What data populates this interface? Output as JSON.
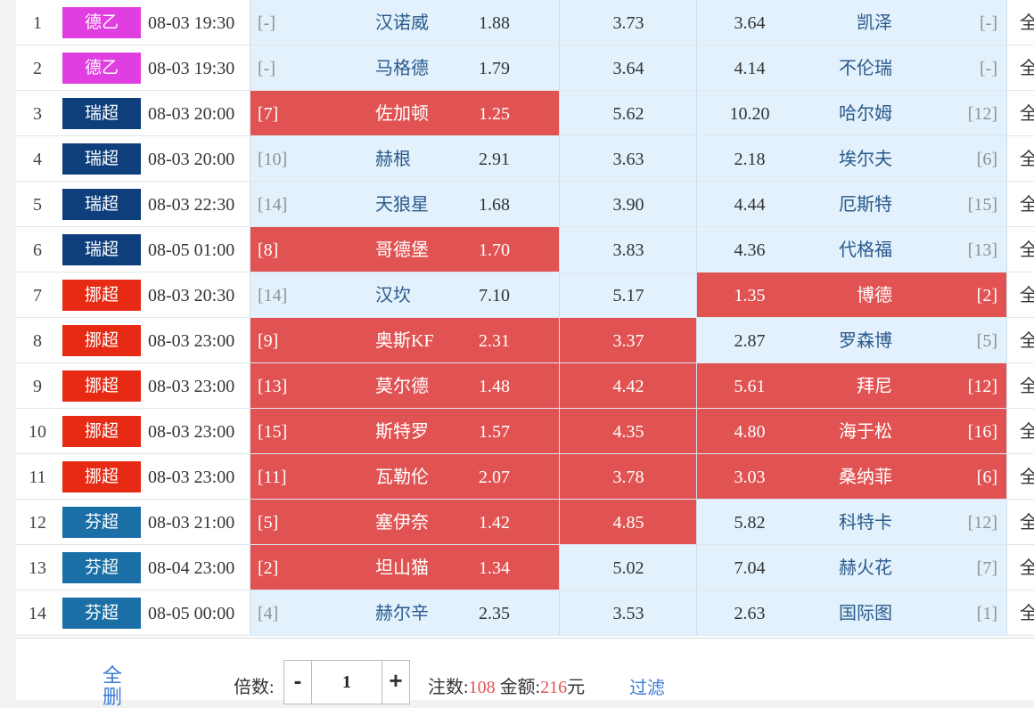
{
  "colors": {
    "德乙": "#e03ee0",
    "瑞超": "#0e3f7c",
    "挪超": "#e62a13",
    "芬超": "#1a6fa7",
    "selected": "#e15353",
    "cell_bg": "#e2f1fc"
  },
  "matches": [
    {
      "no": "1",
      "league": "德乙",
      "time": "08-03 19:30",
      "home_rank": "[-]",
      "home": "汉诺威",
      "win": "1.88",
      "draw": "3.73",
      "lose": "3.64",
      "away": "凯泽",
      "away_rank": "[-]",
      "all": "全",
      "sel_home": false,
      "sel_draw": false,
      "sel_away": false
    },
    {
      "no": "2",
      "league": "德乙",
      "time": "08-03 19:30",
      "home_rank": "[-]",
      "home": "马格德",
      "win": "1.79",
      "draw": "3.64",
      "lose": "4.14",
      "away": "不伦瑞",
      "away_rank": "[-]",
      "all": "全",
      "sel_home": false,
      "sel_draw": false,
      "sel_away": false
    },
    {
      "no": "3",
      "league": "瑞超",
      "time": "08-03 20:00",
      "home_rank": "[7]",
      "home": "佐加顿",
      "win": "1.25",
      "draw": "5.62",
      "lose": "10.20",
      "away": "哈尔姆",
      "away_rank": "[12]",
      "all": "全",
      "sel_home": true,
      "sel_draw": false,
      "sel_away": false
    },
    {
      "no": "4",
      "league": "瑞超",
      "time": "08-03 20:00",
      "home_rank": "[10]",
      "home": "赫根",
      "win": "2.91",
      "draw": "3.63",
      "lose": "2.18",
      "away": "埃尔夫",
      "away_rank": "[6]",
      "all": "全",
      "sel_home": false,
      "sel_draw": false,
      "sel_away": false
    },
    {
      "no": "5",
      "league": "瑞超",
      "time": "08-03 22:30",
      "home_rank": "[14]",
      "home": "天狼星",
      "win": "1.68",
      "draw": "3.90",
      "lose": "4.44",
      "away": "厄斯特",
      "away_rank": "[15]",
      "all": "全",
      "sel_home": false,
      "sel_draw": false,
      "sel_away": false
    },
    {
      "no": "6",
      "league": "瑞超",
      "time": "08-05 01:00",
      "home_rank": "[8]",
      "home": "哥德堡",
      "win": "1.70",
      "draw": "3.83",
      "lose": "4.36",
      "away": "代格福",
      "away_rank": "[13]",
      "all": "全",
      "sel_home": true,
      "sel_draw": false,
      "sel_away": false
    },
    {
      "no": "7",
      "league": "挪超",
      "time": "08-03 20:30",
      "home_rank": "[14]",
      "home": "汉坎",
      "win": "7.10",
      "draw": "5.17",
      "lose": "1.35",
      "away": "博德",
      "away_rank": "[2]",
      "all": "全",
      "sel_home": false,
      "sel_draw": false,
      "sel_away": true
    },
    {
      "no": "8",
      "league": "挪超",
      "time": "08-03 23:00",
      "home_rank": "[9]",
      "home": "奥斯KF",
      "win": "2.31",
      "draw": "3.37",
      "lose": "2.87",
      "away": "罗森博",
      "away_rank": "[5]",
      "all": "全",
      "sel_home": true,
      "sel_draw": true,
      "sel_away": false
    },
    {
      "no": "9",
      "league": "挪超",
      "time": "08-03 23:00",
      "home_rank": "[13]",
      "home": "莫尔德",
      "win": "1.48",
      "draw": "4.42",
      "lose": "5.61",
      "away": "拜尼",
      "away_rank": "[12]",
      "all": "全",
      "sel_home": true,
      "sel_draw": true,
      "sel_away": true
    },
    {
      "no": "10",
      "league": "挪超",
      "time": "08-03 23:00",
      "home_rank": "[15]",
      "home": "斯特罗",
      "win": "1.57",
      "draw": "4.35",
      "lose": "4.80",
      "away": "海于松",
      "away_rank": "[16]",
      "all": "全",
      "sel_home": true,
      "sel_draw": true,
      "sel_away": true
    },
    {
      "no": "11",
      "league": "挪超",
      "time": "08-03 23:00",
      "home_rank": "[11]",
      "home": "瓦勒伦",
      "win": "2.07",
      "draw": "3.78",
      "lose": "3.03",
      "away": "桑纳菲",
      "away_rank": "[6]",
      "all": "全",
      "sel_home": true,
      "sel_draw": true,
      "sel_away": true
    },
    {
      "no": "12",
      "league": "芬超",
      "time": "08-03 21:00",
      "home_rank": "[5]",
      "home": "塞伊奈",
      "win": "1.42",
      "draw": "4.85",
      "lose": "5.82",
      "away": "科特卡",
      "away_rank": "[12]",
      "all": "全",
      "sel_home": true,
      "sel_draw": true,
      "sel_away": false
    },
    {
      "no": "13",
      "league": "芬超",
      "time": "08-04 23:00",
      "home_rank": "[2]",
      "home": "坦山猫",
      "win": "1.34",
      "draw": "5.02",
      "lose": "7.04",
      "away": "赫火花",
      "away_rank": "[7]",
      "all": "全",
      "sel_home": true,
      "sel_draw": false,
      "sel_away": false
    },
    {
      "no": "14",
      "league": "芬超",
      "time": "08-05 00:00",
      "home_rank": "[4]",
      "home": "赫尔辛",
      "win": "2.35",
      "draw": "3.53",
      "lose": "2.63",
      "away": "国际图",
      "away_rank": "[1]",
      "all": "全",
      "sel_home": false,
      "sel_draw": false,
      "sel_away": false
    }
  ],
  "footer": {
    "all_label": "全删",
    "multiplier_label": "倍数:",
    "minus": "-",
    "plus": "+",
    "multiplier_value": "1",
    "bets_label": "注数:",
    "bets_value": "108",
    "amount_label": "金额:",
    "amount_value": "216",
    "amount_unit": "元",
    "filter_label": "过滤"
  }
}
